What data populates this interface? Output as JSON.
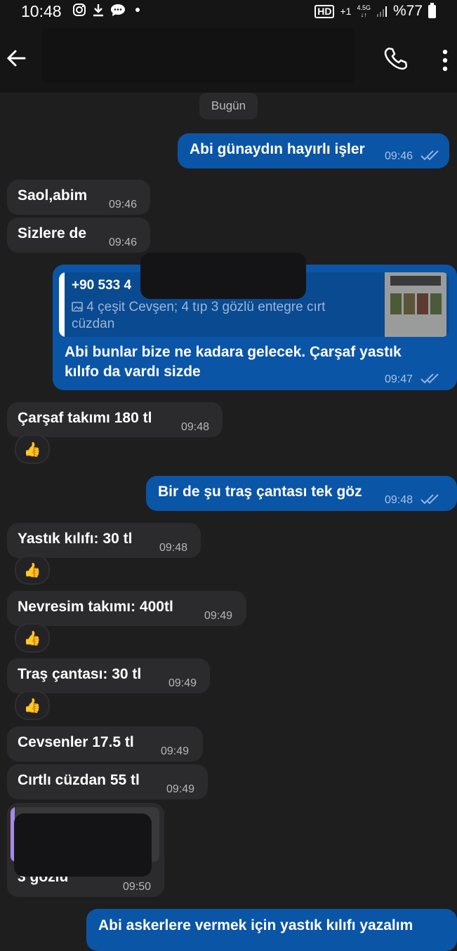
{
  "status_bar": {
    "time": "10:48",
    "battery": "%77",
    "hd_label": "HD",
    "network": "4.5G",
    "plus": "+1"
  },
  "date_chip": "Bugün",
  "messages": [
    {
      "text": "Abi günaydın hayırlı işler",
      "time": "09:46",
      "dir": "out"
    },
    {
      "text": "Saol,abim",
      "time": "09:46",
      "dir": "in"
    },
    {
      "text": "Sizlere de",
      "time": "09:46",
      "dir": "in"
    },
    {
      "quote_number": "+90 533 4",
      "quote_text": "4 çeşit Cevşen; 4 tıp 3 gözlü entegre cırt cüzdan",
      "text_line1": "Abi bunlar bize ne kadara gelecek. Çarşaf yastık",
      "text_line2": "kılıfo da vardı sizde",
      "time": "09:47",
      "dir": "out"
    },
    {
      "text": "Çarşaf takımı 180 tl",
      "time": "09:48",
      "dir": "in",
      "reaction": "👍"
    },
    {
      "text": "Bir de şu traş çantası tek göz",
      "time": "09:48",
      "dir": "out"
    },
    {
      "text": "Yastık kılıfı: 30 tl",
      "time": "09:48",
      "dir": "in",
      "reaction": "👍"
    },
    {
      "text": "Nevresim takımı: 400tl",
      "time": "09:49",
      "dir": "in",
      "reaction": "👍"
    },
    {
      "text": "Traş çantası: 30 tl",
      "time": "09:49",
      "dir": "in",
      "reaction": "👍"
    },
    {
      "text": "Cevsenler 17.5 tl",
      "time": "09:49",
      "dir": "in"
    },
    {
      "text": "Cırtlı cüzdan 55 tl",
      "time": "09:49",
      "dir": "in"
    },
    {
      "text": "3 gözlü",
      "time": "09:50",
      "dir": "in"
    },
    {
      "text": "Abi askerlere vermek için yastık kılıfı yazalım",
      "dir": "out"
    }
  ],
  "colors": {
    "outgoing": "#0b55a6",
    "incoming": "#2b2b2d",
    "background": "#1e1e1f"
  }
}
